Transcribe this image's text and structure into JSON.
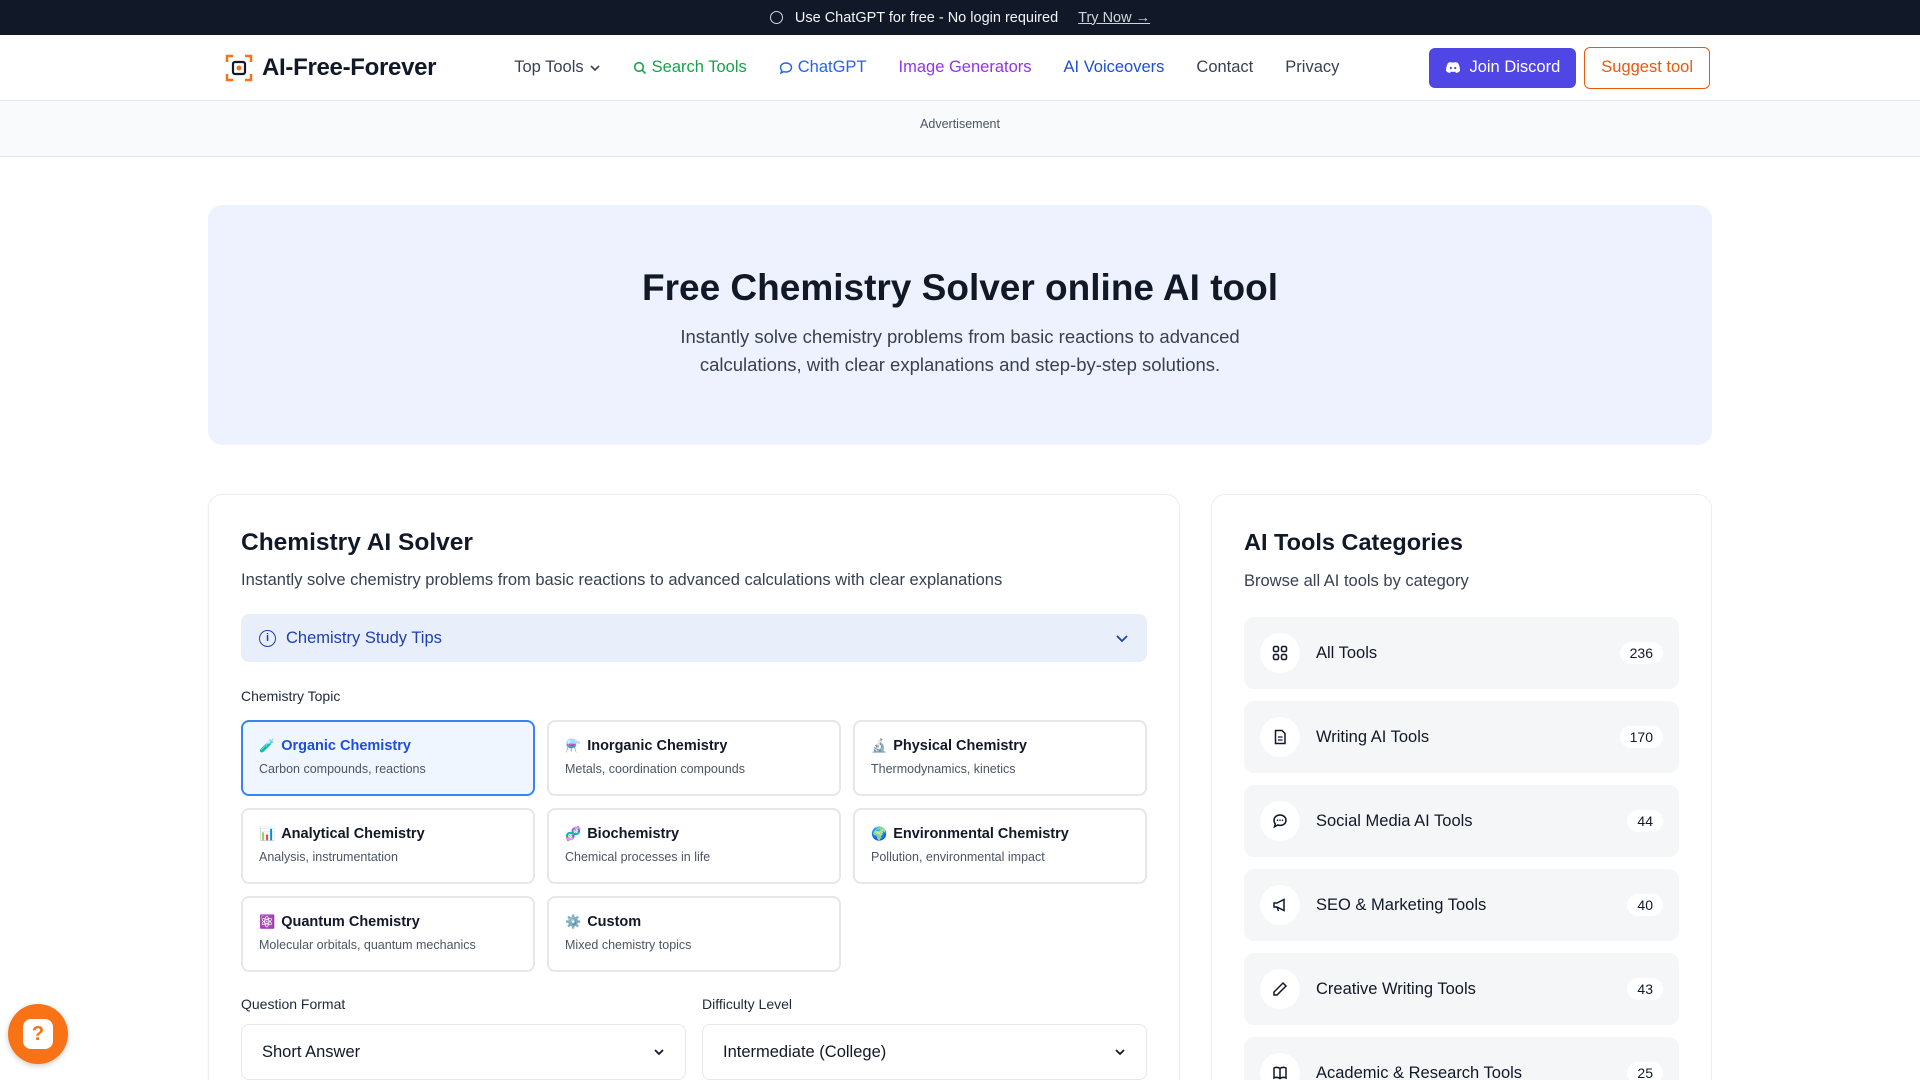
{
  "banner": {
    "text": "Use ChatGPT for free - No login required",
    "link": "Try Now →"
  },
  "nav": {
    "brand": "AI-Free-Forever",
    "links": [
      {
        "label": "Top Tools",
        "icon": "chevron-down-icon"
      },
      {
        "label": "Search Tools",
        "icon": "search-icon"
      },
      {
        "label": "ChatGPT",
        "icon": "chat-bubble-icon"
      },
      {
        "label": "Image Generators"
      },
      {
        "label": "AI Voiceovers"
      },
      {
        "label": "Contact"
      },
      {
        "label": "Privacy"
      }
    ],
    "discord": "Join Discord",
    "suggest": "Suggest tool"
  },
  "ad": {
    "label": "Advertisement"
  },
  "hero": {
    "title": "Free Chemistry Solver online AI tool",
    "line1": "Instantly solve chemistry problems from basic reactions to advanced",
    "line2": "calculations, with clear explanations and step-by-step solutions."
  },
  "solver": {
    "title": "Chemistry AI Solver",
    "subtitle": "Instantly solve chemistry problems from basic reactions to advanced calculations with clear explanations",
    "tips": "Chemistry Study Tips",
    "topic_label": "Chemistry Topic",
    "topics": [
      {
        "emoji": "🧪",
        "title": "Organic Chemistry",
        "desc": "Carbon compounds, reactions"
      },
      {
        "emoji": "⚗️",
        "title": "Inorganic Chemistry",
        "desc": "Metals, coordination compounds"
      },
      {
        "emoji": "🔬",
        "title": "Physical Chemistry",
        "desc": "Thermodynamics, kinetics"
      },
      {
        "emoji": "📊",
        "title": "Analytical Chemistry",
        "desc": "Analysis, instrumentation"
      },
      {
        "emoji": "🧬",
        "title": "Biochemistry",
        "desc": "Chemical processes in life"
      },
      {
        "emoji": "🌍",
        "title": "Environmental Chemistry",
        "desc": "Pollution, environmental impact"
      },
      {
        "emoji": "⚛️",
        "title": "Quantum Chemistry",
        "desc": "Molecular orbitals, quantum mechanics"
      },
      {
        "emoji": "⚙️",
        "title": "Custom",
        "desc": "Mixed chemistry topics"
      }
    ],
    "format_label": "Question Format",
    "format_value": "Short Answer",
    "difficulty_label": "Difficulty Level",
    "difficulty_value": "Intermediate (College)"
  },
  "categories": {
    "title": "AI Tools Categories",
    "subtitle": "Browse all AI tools by category",
    "items": [
      {
        "name": "All Tools",
        "count": "236",
        "icon": "grid-icon"
      },
      {
        "name": "Writing AI Tools",
        "count": "170",
        "icon": "document-icon"
      },
      {
        "name": "Social Media AI Tools",
        "count": "44",
        "icon": "chat-icon"
      },
      {
        "name": "SEO & Marketing Tools",
        "count": "40",
        "icon": "megaphone-icon"
      },
      {
        "name": "Creative Writing Tools",
        "count": "43",
        "icon": "pencil-icon"
      },
      {
        "name": "Academic & Research Tools",
        "count": "25",
        "icon": "book-icon"
      }
    ]
  }
}
